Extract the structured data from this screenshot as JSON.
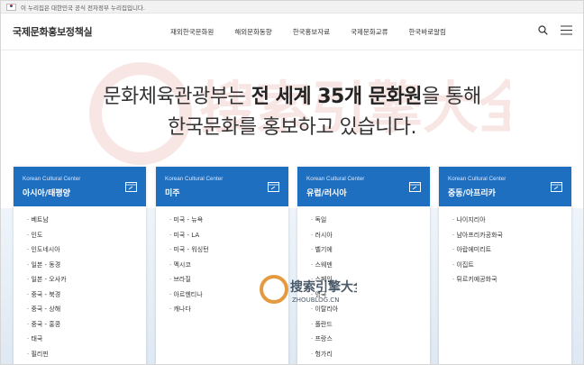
{
  "gov_bar": {
    "text": "이 누리집은 대한민국 공식 전자정부 누리집입니다."
  },
  "header": {
    "logo": "국제문화홍보정책실",
    "nav": [
      "재외한국문화원",
      "해외문화동향",
      "한국홍보자료",
      "국제문화교류",
      "한국바로알림"
    ]
  },
  "hero": {
    "line1_pre": "문화체육관광부는 ",
    "line1_bold": "전 세계 35개 문화원",
    "line1_post": "을 통해",
    "line2": "한국문화를 홍보하고 있습니다."
  },
  "watermark": {
    "text": "搜索引擎大全",
    "sub": "ZHOUBLOG.CN"
  },
  "cards": [
    {
      "sub": "Korean Cultural Center",
      "title": "아시아/태평양",
      "items": [
        "베트남",
        "인도",
        "인도네시아",
        "일본 - 동경",
        "일본 - 오사카",
        "중국 - 북경",
        "중국 - 상해",
        "중국 - 홍콩",
        "태국",
        "필리핀"
      ]
    },
    {
      "sub": "Korean Cultural Center",
      "title": "미주",
      "items": [
        "미국 - 뉴욕",
        "미국 - LA",
        "미국 - 워싱턴",
        "멕시코",
        "브라질",
        "아르헨티나",
        "캐나다"
      ]
    },
    {
      "sub": "Korean Cultural Center",
      "title": "유럽/러시아",
      "items": [
        "독일",
        "러시아",
        "벨기에",
        "스웨덴",
        "스페인",
        "영국",
        "이탈리아",
        "폴란드",
        "프랑스",
        "헝가리"
      ]
    },
    {
      "sub": "Korean Cultural Center",
      "title": "중동/아프리카",
      "items": [
        "나이지리아",
        "남아프리카공화국",
        "아랍에미리트",
        "이집트",
        "튀르키예공화국"
      ]
    }
  ],
  "colors": {
    "card_header": "#1f6fc0",
    "text": "#333333"
  }
}
